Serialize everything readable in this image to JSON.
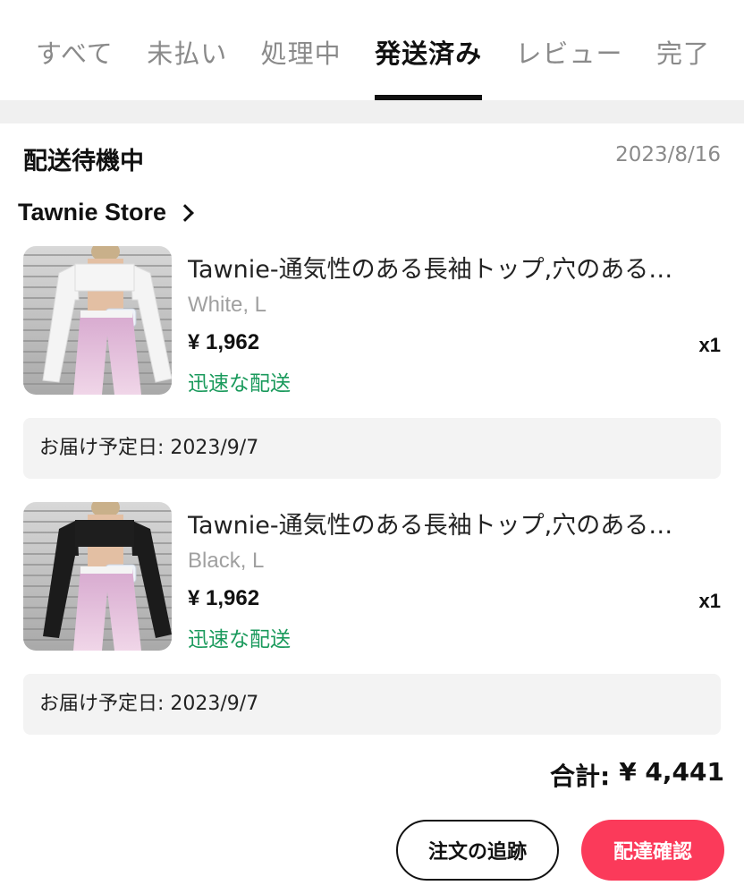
{
  "tabs": [
    {
      "label": "すべて"
    },
    {
      "label": "未払い"
    },
    {
      "label": "処理中"
    },
    {
      "label": "発送済み"
    },
    {
      "label": "レビュー"
    },
    {
      "label": "完了"
    }
  ],
  "active_tab_index": 3,
  "order": {
    "status": "配送待機中",
    "date": "2023/8/16",
    "store": "Tawnie Store",
    "items": [
      {
        "title": "Tawnie-通気性のある長袖トップ,穴のある…",
        "variant": "White, L",
        "price": "¥ 1,962",
        "qty": "x1",
        "shipping": "迅速な配送",
        "delivery": "お届け予定日: 2023/9/7",
        "top_color": "white"
      },
      {
        "title": "Tawnie-通気性のある長袖トップ,穴のある…",
        "variant": "Black, L",
        "price": "¥ 1,962",
        "qty": "x1",
        "shipping": "迅速な配送",
        "delivery": "お届け予定日: 2023/9/7",
        "top_color": "black"
      }
    ],
    "total_label": "合計:",
    "total_value": "¥ 4,441"
  },
  "actions": {
    "track_label": "注文の追跡",
    "confirm_label": "配達確認"
  },
  "colors": {
    "accent": "#fb3a5a",
    "shipping_green": "#1a9a5c",
    "muted": "#8a8a8a"
  },
  "icons": {
    "store_arrow": "chevron-right-icon"
  }
}
